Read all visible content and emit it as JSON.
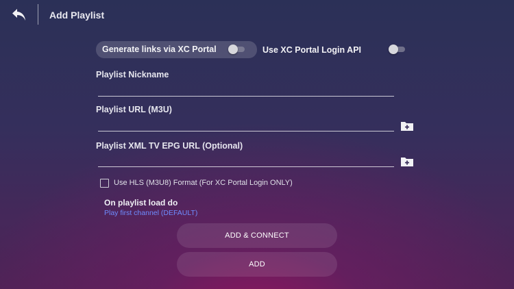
{
  "header": {
    "title": "Add Playlist",
    "back_icon": "back-arrow-icon"
  },
  "toggles": {
    "xc_portal_links": {
      "label": "Generate links via XC Portal",
      "enabled": false
    },
    "xc_login_api": {
      "label": "Use XC Portal Login API",
      "enabled": false
    }
  },
  "fields": {
    "nickname": {
      "label": "Playlist Nickname",
      "value": "",
      "placeholder": ""
    },
    "url": {
      "label": "Playlist URL (M3U)",
      "value": "",
      "placeholder": ""
    },
    "epg": {
      "label": "Playlist XML TV EPG URL (Optional)",
      "value": "",
      "placeholder": ""
    }
  },
  "hls": {
    "label": "Use HLS (M3U8) Format (For XC Portal Login ONLY)",
    "checked": false
  },
  "on_load": {
    "title": "On playlist load do",
    "selected": "Play first channel (DEFAULT)"
  },
  "buttons": {
    "add_connect": "ADD & CONNECT",
    "add": "ADD"
  },
  "colors": {
    "accent_link": "#6f8cff",
    "background_top": "#2b3057",
    "background_glow": "#96145f"
  }
}
